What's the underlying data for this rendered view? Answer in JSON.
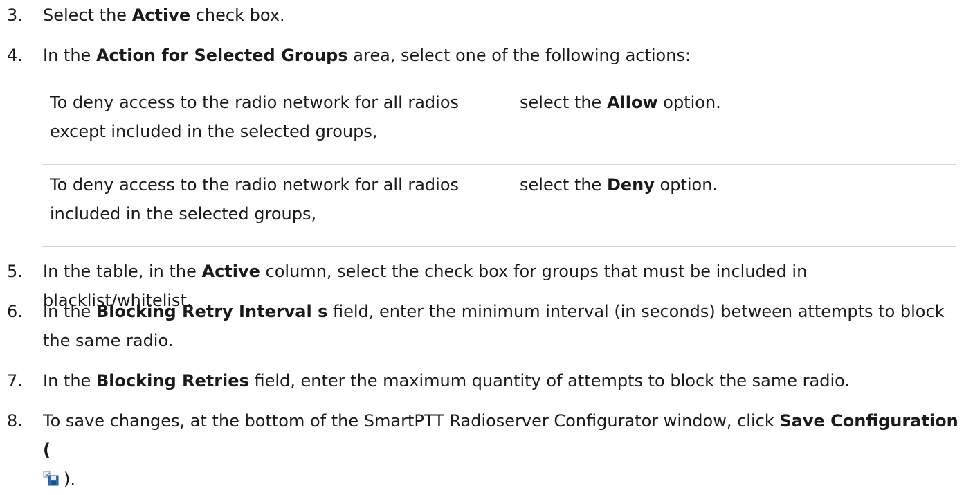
{
  "steps": [
    {
      "num": "3.",
      "pre": "Select the ",
      "b1": "Active",
      "post": " check box."
    },
    {
      "num": "4.",
      "pre": "In the ",
      "b1": "Action for Selected Groups",
      "post": " area, select one of the following actions:"
    },
    {
      "num": "5.",
      "pre": "In the table, in the ",
      "b1": "Active",
      "post": " column, select the check box for groups that must be included in blacklist/whitelist."
    },
    {
      "num": "6.",
      "pre": "In the ",
      "b1": "Blocking Retry Interval s",
      "post": " field, enter the minimum interval (in seconds) between attempts to block the same radio."
    },
    {
      "num": "7.",
      "pre": "In the ",
      "b1": "Blocking Retries",
      "post": " field, enter the maximum quantity of attempts to block the same radio."
    },
    {
      "num": "8.",
      "pre": "To save changes, at the bottom of the SmartPTT Radioserver Configurator window, click ",
      "b1": "Save Configuration (",
      "post": ").",
      "icon": "save-configuration-icon"
    }
  ],
  "options": [
    {
      "condition": "To deny access to the radio network for all radios except included in the selected groups,",
      "pre": "select the ",
      "bold": "Allow",
      "post": " option."
    },
    {
      "condition": "To deny access to the radio network for all radios included in the selected groups,",
      "pre": "select the ",
      "bold": "Deny",
      "post": " option."
    }
  ]
}
